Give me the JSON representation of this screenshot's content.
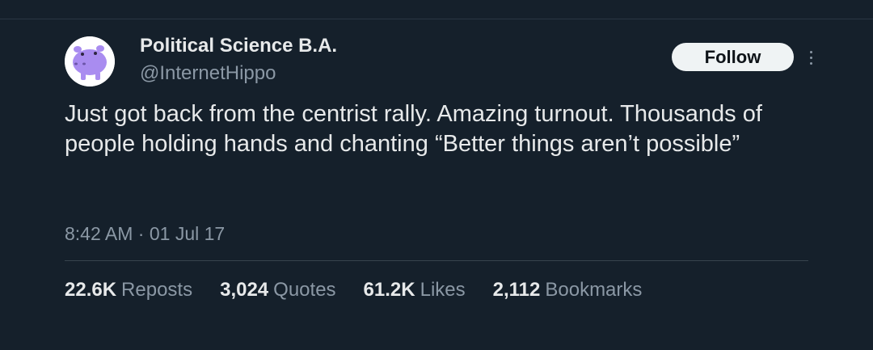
{
  "author": {
    "display_name": "Political Science B.A.",
    "handle": "@InternetHippo"
  },
  "actions": {
    "follow_label": "Follow",
    "more_icon": "more-vertical-icon"
  },
  "tweet": {
    "text": "Just got back from the centrist rally. Amazing turnout. Thousands of people holding hands and chanting “Better things aren’t possible”",
    "time": "8:42 AM",
    "separator": " · ",
    "date": "01 Jul 17"
  },
  "stats": [
    {
      "count": "22.6K",
      "label": "Reposts"
    },
    {
      "count": "3,024",
      "label": "Quotes"
    },
    {
      "count": "61.2K",
      "label": "Likes"
    },
    {
      "count": "2,112",
      "label": "Bookmarks"
    }
  ],
  "colors": {
    "background": "#15202b",
    "primary_text": "#e7e9ea",
    "secondary_text": "#8b98a5",
    "follow_button": "#eff3f4",
    "avatar_hippo": "#a98cf0"
  }
}
